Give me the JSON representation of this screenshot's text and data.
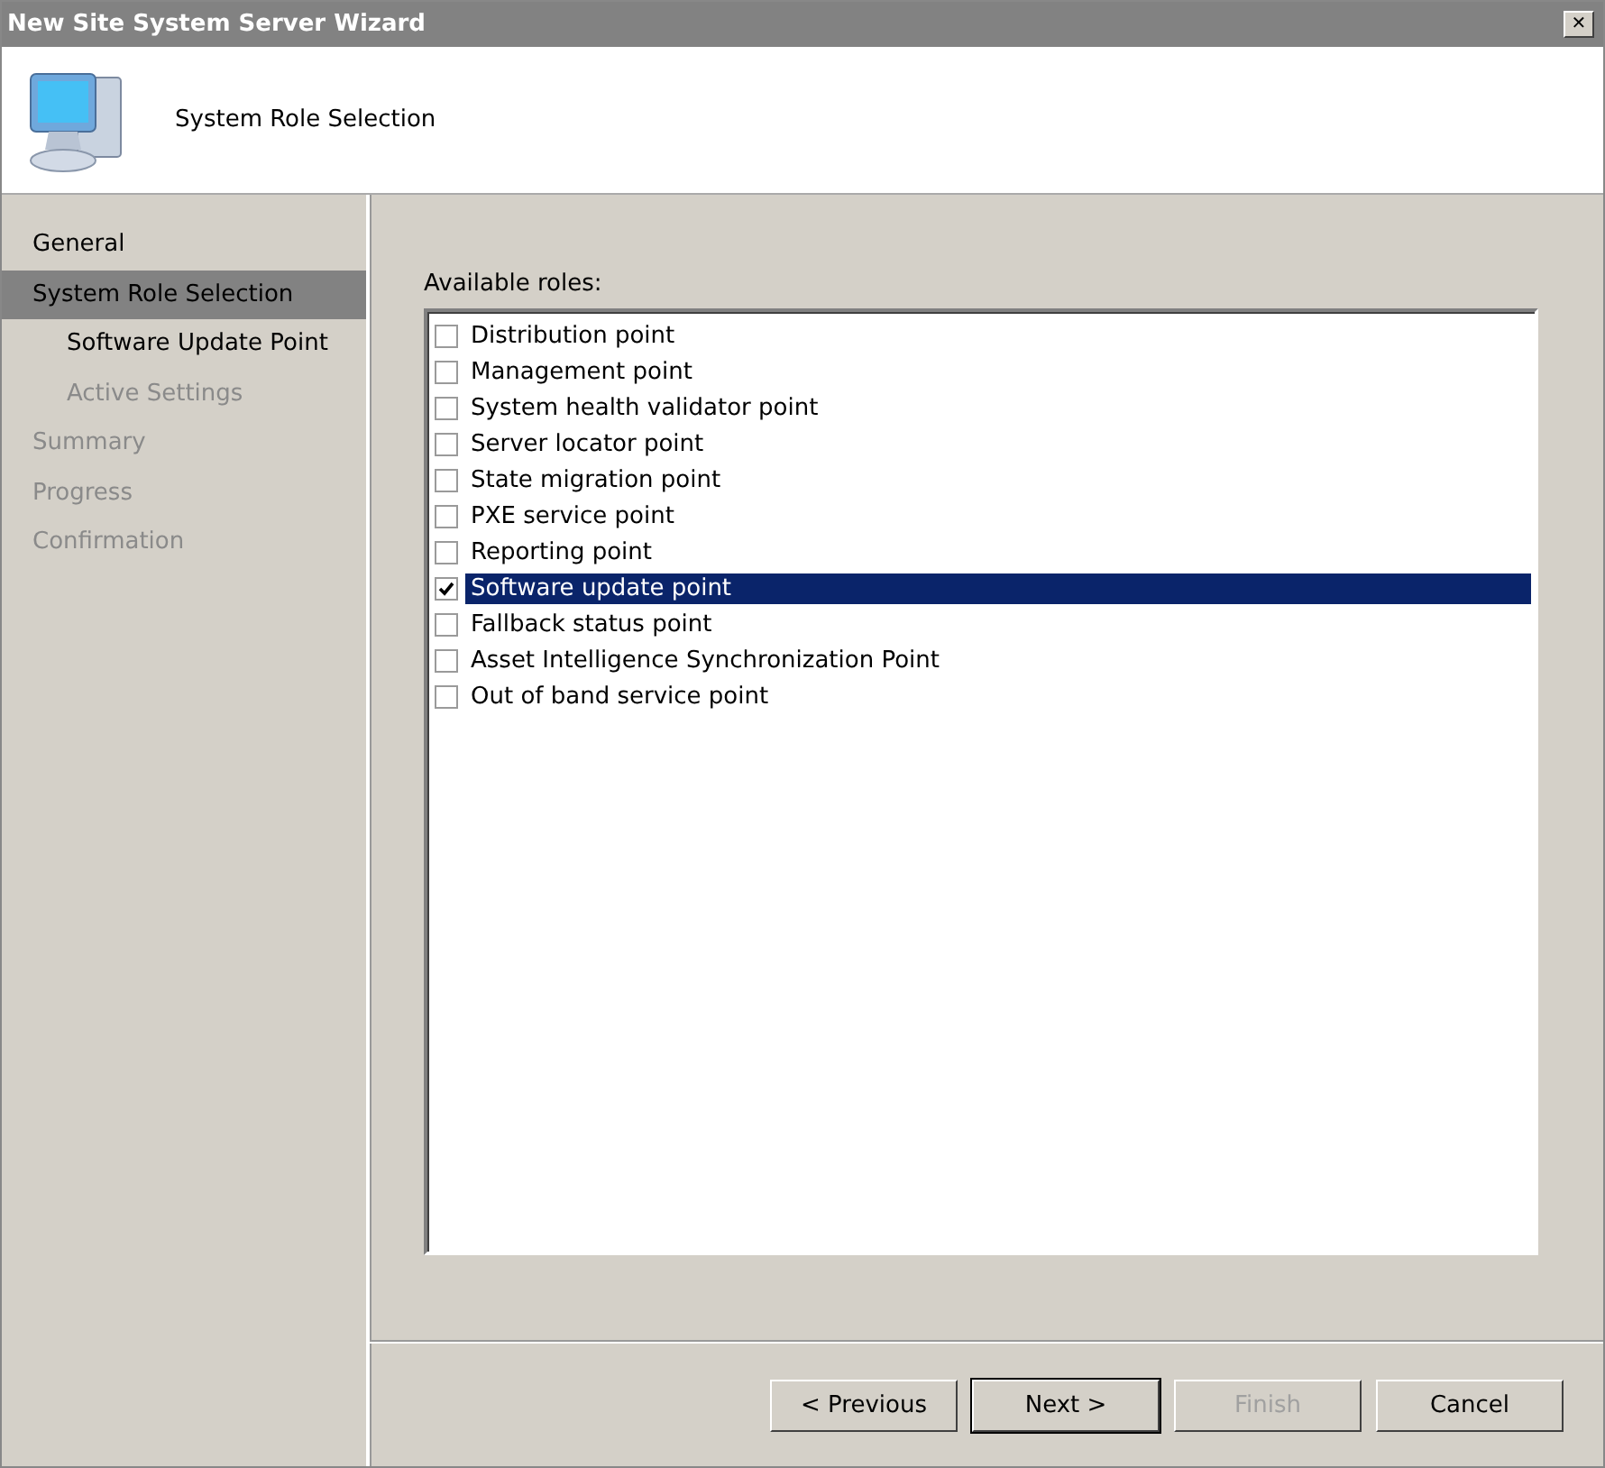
{
  "window": {
    "title": "New Site System Server Wizard",
    "close": "✕"
  },
  "header": {
    "title": "System Role Selection"
  },
  "sidebar": {
    "items": [
      {
        "label": "General",
        "selected": false,
        "disabled": false
      },
      {
        "label": "System Role Selection",
        "selected": true,
        "disabled": false,
        "children": [
          {
            "label": "Software Update Point",
            "selected": false,
            "disabled": false
          },
          {
            "label": "Active Settings",
            "selected": false,
            "disabled": true
          }
        ]
      },
      {
        "label": "Summary",
        "selected": false,
        "disabled": true
      },
      {
        "label": "Progress",
        "selected": false,
        "disabled": true
      },
      {
        "label": "Confirmation",
        "selected": false,
        "disabled": true
      }
    ]
  },
  "roles": {
    "label": "Available roles:",
    "items": [
      {
        "label": "Distribution point",
        "checked": false,
        "selected": false
      },
      {
        "label": "Management point",
        "checked": false,
        "selected": false
      },
      {
        "label": "System health validator point",
        "checked": false,
        "selected": false
      },
      {
        "label": "Server locator point",
        "checked": false,
        "selected": false
      },
      {
        "label": "State migration point",
        "checked": false,
        "selected": false
      },
      {
        "label": "PXE service point",
        "checked": false,
        "selected": false
      },
      {
        "label": "Reporting point",
        "checked": false,
        "selected": false
      },
      {
        "label": "Software update point",
        "checked": true,
        "selected": true
      },
      {
        "label": "Fallback status point",
        "checked": false,
        "selected": false
      },
      {
        "label": "Asset Intelligence Synchronization Point",
        "checked": false,
        "selected": false
      },
      {
        "label": "Out of band service point",
        "checked": false,
        "selected": false
      }
    ]
  },
  "buttons": [
    {
      "label": "< Previous",
      "disabled": false,
      "default": false
    },
    {
      "label": "Next >",
      "disabled": false,
      "default": true
    },
    {
      "label": "Finish",
      "disabled": true,
      "default": false
    },
    {
      "label": "Cancel",
      "disabled": false,
      "default": false
    }
  ]
}
